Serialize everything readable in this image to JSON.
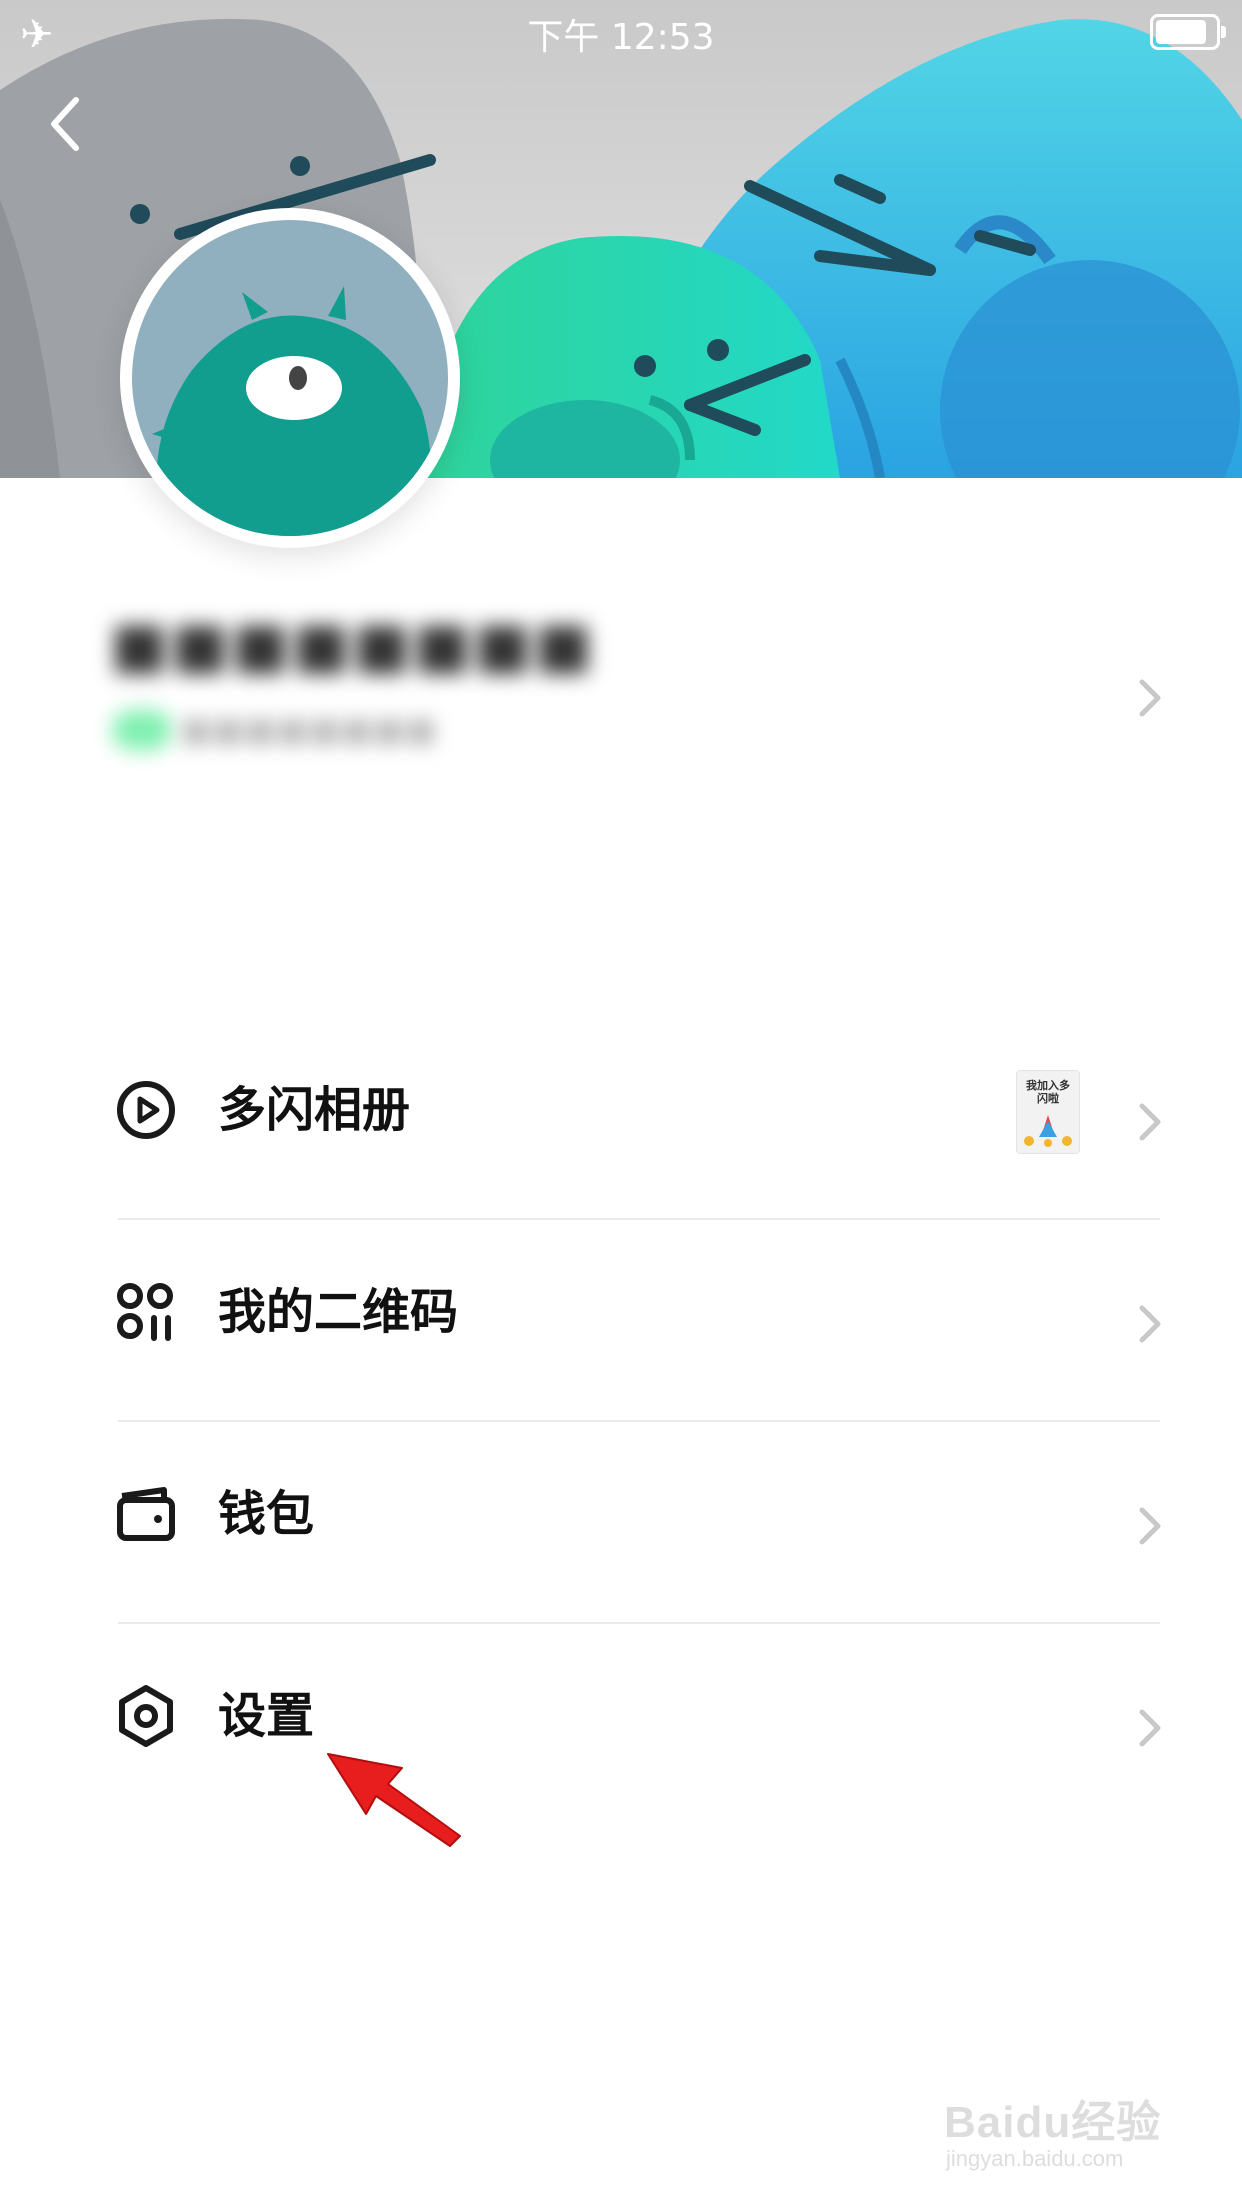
{
  "status_bar": {
    "time": "下午 12:53",
    "airplane_icon": "airplane-icon",
    "battery_icon": "battery-icon"
  },
  "header": {
    "back_icon": "chevron-left-icon"
  },
  "menu": [
    {
      "label": "多闪相册",
      "icon": "play-circle-icon",
      "thumbnail_text": "我加入多闪啦"
    },
    {
      "label": "我的二维码",
      "icon": "qr-dots-icon"
    },
    {
      "label": "钱包",
      "icon": "wallet-icon"
    },
    {
      "label": "设置",
      "icon": "settings-hex-icon"
    }
  ],
  "watermark": {
    "logo": "Baidu经验",
    "url": "jingyan.baidu.com"
  },
  "colors": {
    "accent_teal": "#119e8f",
    "header_blue": "#2aa6e0",
    "annotation_arrow": "#e11a1a"
  }
}
